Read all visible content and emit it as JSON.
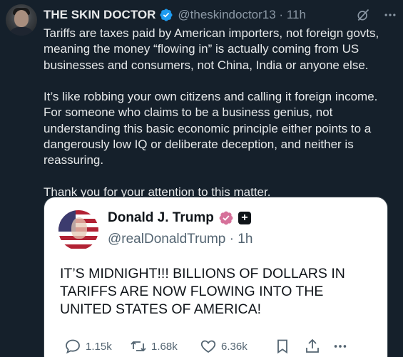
{
  "tweet": {
    "author_name": "THE SKIN DOCTOR",
    "author_handle": "@theskindoctor13",
    "time": "11h",
    "paragraphs": [
      "Tariffs are taxes paid by American importers, not foreign govts, meaning the money “flowing in” is actually coming from US businesses and consumers, not China, India or anyone else.",
      "It’s like robbing your own citizens and calling it foreign income. For someone who claims to be a business genius, not understanding this basic economic principle either points to a dangerously low IQ or deliberate deception, and neither is reassuring.",
      "Thank you for your attention to this matter."
    ],
    "icons": {
      "avatar": "profile-photo",
      "verified": "verified-badge-icon",
      "grok": "grok-icon",
      "more": "more-icon"
    }
  },
  "quoted": {
    "author_name": "Donald J. Trump",
    "author_handle": "@realDonaldTrump",
    "time": "1h",
    "text": "IT’S MIDNIGHT!!! BILLIONS OF DOLLARS IN TARIFFS ARE NOW FLOWING INTO THE UNITED STATES OF AMERICA!",
    "stats": {
      "replies": "1.15k",
      "reposts": "1.68k",
      "likes": "6.36k"
    }
  },
  "colors": {
    "background": "#15202b",
    "text_primary": "#e7e9ea",
    "text_secondary": "#8b98a5",
    "verified_blue": "#1d9bf0",
    "quote_bg": "#ffffff",
    "quote_muted": "#536471"
  }
}
